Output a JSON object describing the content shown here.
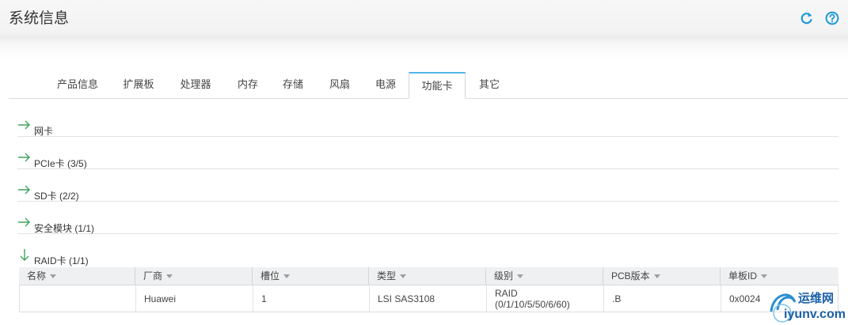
{
  "page": {
    "title": "系统信息"
  },
  "header_icons": {
    "refresh": "refresh-icon",
    "help": "help-icon"
  },
  "tabs": [
    {
      "label": "产品信息"
    },
    {
      "label": "扩展板"
    },
    {
      "label": "处理器"
    },
    {
      "label": "内存"
    },
    {
      "label": "存储"
    },
    {
      "label": "风扇"
    },
    {
      "label": "电源"
    },
    {
      "label": "功能卡",
      "active": true
    },
    {
      "label": "其它"
    }
  ],
  "sections": [
    {
      "label": "网卡",
      "state": "collapsed"
    },
    {
      "label": "PCIe卡 (3/5)",
      "state": "collapsed"
    },
    {
      "label": "SD卡 (2/2)",
      "state": "collapsed"
    },
    {
      "label": "安全模块 (1/1)",
      "state": "collapsed"
    },
    {
      "label": "RAID卡 (1/1)",
      "state": "expanded"
    }
  ],
  "raid_table": {
    "columns": [
      "名称",
      "厂商",
      "槽位",
      "类型",
      "级别",
      "PCB版本",
      "单板ID"
    ],
    "rows": [
      {
        "name": "",
        "vendor": "Huawei",
        "slot": "1",
        "type": "LSI SAS3108",
        "level_line1": "RAID",
        "level_line2": "(0/1/10/5/50/6/60)",
        "pcb": ".B",
        "board_id": "0x0024"
      }
    ]
  },
  "watermark": {
    "text": "运维网",
    "url_text": "iyunv.com"
  },
  "colors": {
    "accent": "#1e9ad6",
    "tab_active_border": "#4fb6e6",
    "arrow": "#3fa45b"
  }
}
